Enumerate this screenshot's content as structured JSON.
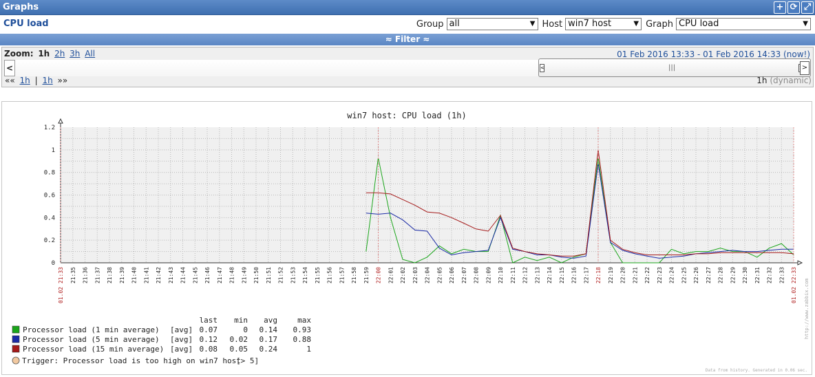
{
  "window": {
    "title": "Graphs",
    "buttons": [
      "plus-icon",
      "refresh-icon",
      "fullscreen-icon"
    ]
  },
  "header": {
    "page_title": "CPU load",
    "group_label": "Group",
    "group_value": "all",
    "host_label": "Host",
    "host_value": "win7 host",
    "graph_label": "Graph",
    "graph_value": "CPU load"
  },
  "filter": {
    "label": "≈ Filter ≈"
  },
  "zoom": {
    "label": "Zoom:",
    "options": [
      "1h",
      "2h",
      "3h",
      "All"
    ],
    "active": "1h",
    "period_text": "01 Feb 2016 13:33  -  01 Feb 2016 14:33 (now!)",
    "nav_back": "««",
    "nav_fwd": "»»",
    "nav_left": "1h",
    "nav_sep": "|",
    "nav_right": "1h",
    "period_len": "1h",
    "dynamic": "(dynamic)"
  },
  "chart_data": {
    "type": "line",
    "title": "win7 host: CPU load (1h)",
    "ylim": [
      0,
      1.2
    ],
    "y_ticks": [
      "0",
      "0.2",
      "0.4",
      "0.6",
      "0.8",
      "1",
      "1.2"
    ],
    "x_labels": [
      "01.02 21:33",
      "21:35",
      "21:36",
      "21:37",
      "21:38",
      "21:39",
      "21:40",
      "21:41",
      "21:42",
      "21:43",
      "21:44",
      "21:45",
      "21:46",
      "21:47",
      "21:48",
      "21:49",
      "21:50",
      "21:51",
      "21:52",
      "21:53",
      "21:54",
      "21:55",
      "21:56",
      "21:57",
      "21:58",
      "21:59",
      "22:00",
      "22:01",
      "22:02",
      "22:03",
      "22:04",
      "22:05",
      "22:06",
      "22:07",
      "22:08",
      "22:09",
      "22:10",
      "22:11",
      "22:12",
      "22:13",
      "22:14",
      "22:15",
      "22:16",
      "22:17",
      "22:18",
      "22:19",
      "22:20",
      "22:21",
      "22:22",
      "22:23",
      "22:24",
      "22:25",
      "22:26",
      "22:27",
      "22:28",
      "22:29",
      "22:30",
      "22:31",
      "22:32",
      "22:33",
      "01.02 22:33"
    ],
    "x_red_labels": [
      "01.02 21:33",
      "22:00",
      "22:18",
      "01.02 22:33"
    ],
    "series": [
      {
        "name": "Processor load (1 min average)",
        "color": "#1aa51a",
        "minute": [
          26,
          27,
          28,
          29,
          30,
          31,
          32,
          33,
          34,
          35,
          36,
          37,
          38,
          39,
          40,
          41,
          42,
          43,
          44,
          45,
          46,
          47,
          48,
          49,
          50,
          51,
          52,
          53,
          54,
          55,
          56,
          57,
          58,
          59,
          60
        ],
        "values": [
          0.1,
          0.93,
          0.4,
          0.03,
          0.0,
          0.05,
          0.15,
          0.08,
          0.12,
          0.1,
          0.1,
          0.42,
          0.0,
          0.05,
          0.02,
          0.05,
          0.0,
          0.05,
          0.08,
          0.93,
          0.18,
          0.0,
          0.0,
          0.0,
          0.0,
          0.12,
          0.08,
          0.1,
          0.1,
          0.13,
          0.1,
          0.1,
          0.05,
          0.13,
          0.17,
          0.07
        ]
      },
      {
        "name": "Processor load (5 min average)",
        "color": "#1a2aa5",
        "minute": [
          26,
          27,
          28,
          29,
          30,
          31,
          32,
          33,
          34,
          35,
          36,
          37,
          38,
          39,
          40,
          41,
          42,
          43,
          44,
          45,
          46,
          47,
          48,
          49,
          50,
          51,
          52,
          53,
          54,
          55,
          56,
          57,
          58,
          59,
          60
        ],
        "values": [
          0.44,
          0.43,
          0.44,
          0.38,
          0.29,
          0.28,
          0.13,
          0.07,
          0.09,
          0.1,
          0.11,
          0.4,
          0.12,
          0.1,
          0.07,
          0.07,
          0.05,
          0.04,
          0.06,
          0.88,
          0.18,
          0.11,
          0.08,
          0.06,
          0.04,
          0.05,
          0.06,
          0.08,
          0.09,
          0.1,
          0.11,
          0.1,
          0.1,
          0.11,
          0.12,
          0.12
        ]
      },
      {
        "name": "Processor load (15 min average)",
        "color": "#a51a1a",
        "minute": [
          26,
          27,
          28,
          29,
          30,
          31,
          32,
          33,
          34,
          35,
          36,
          37,
          38,
          39,
          40,
          41,
          42,
          43,
          44,
          45,
          46,
          47,
          48,
          49,
          50,
          51,
          52,
          53,
          54,
          55,
          56,
          57,
          58,
          59,
          60
        ],
        "values": [
          0.62,
          0.62,
          0.61,
          0.56,
          0.51,
          0.45,
          0.44,
          0.4,
          0.35,
          0.3,
          0.28,
          0.42,
          0.13,
          0.1,
          0.08,
          0.07,
          0.06,
          0.06,
          0.08,
          1.0,
          0.2,
          0.12,
          0.09,
          0.07,
          0.07,
          0.07,
          0.07,
          0.08,
          0.08,
          0.09,
          0.09,
          0.09,
          0.09,
          0.09,
          0.09,
          0.08
        ]
      }
    ],
    "legend_headers": [
      "last",
      "min",
      "avg",
      "max"
    ],
    "legend": [
      {
        "name": "Processor load (1 min average)",
        "func": "[avg]",
        "last": "0.07",
        "min": "0",
        "avg": "0.14",
        "max": "0.93",
        "color": "#1aa51a"
      },
      {
        "name": "Processor load (5 min average)",
        "func": "[avg]",
        "last": "0.12",
        "min": "0.02",
        "avg": "0.17",
        "max": "0.88",
        "color": "#1a2aa5"
      },
      {
        "name": "Processor load (15 min average)",
        "func": "[avg]",
        "last": "0.08",
        "min": "0.05",
        "avg": "0.24",
        "max": "1",
        "color": "#a51a1a"
      }
    ],
    "trigger": {
      "text": "Trigger: Processor load is too high on win7 host",
      "value": "[> 5]",
      "color": "#f2c9a0"
    },
    "watermark": "http://www.zabbix.com",
    "footer_note": "Data from history. Generated in 0.06 sec."
  }
}
